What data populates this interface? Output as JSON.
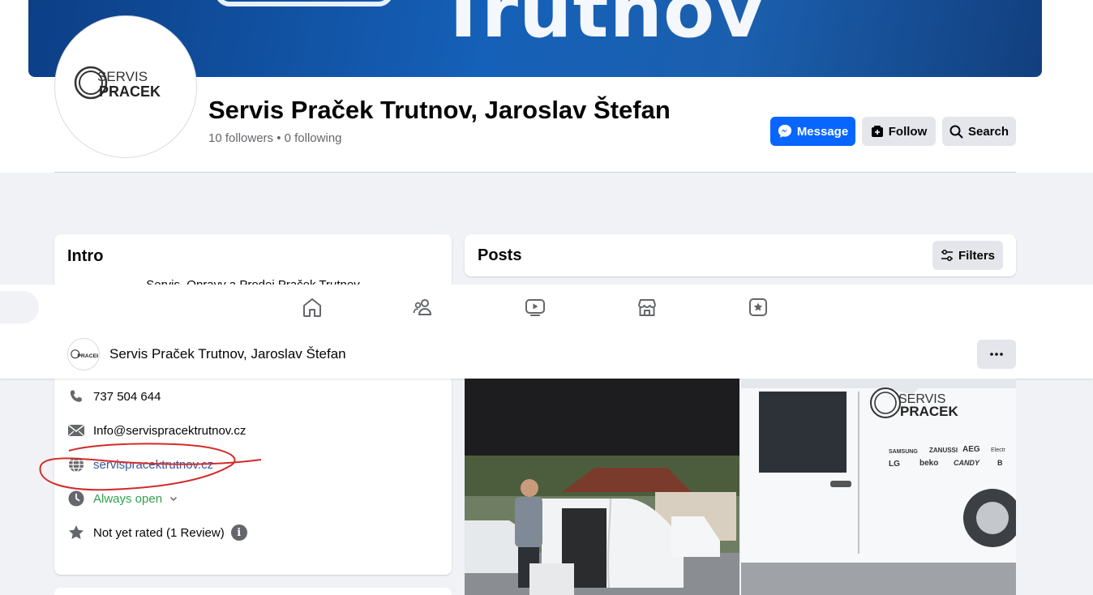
{
  "cover": {
    "text": "Trutnov"
  },
  "profile": {
    "name": "Servis Praček Trutnov, Jaroslav Štefan",
    "stats": "10 followers • 0 following",
    "logo_text_top": "SERVIS",
    "logo_text_bottom": "PRACEK"
  },
  "actions": {
    "message": "Message",
    "follow": "Follow",
    "search": "Search"
  },
  "intro": {
    "title": "Intro",
    "description": "Servis, Opravy a Prodej Praček Trutnov",
    "phone": "737 504 644",
    "email": "Info@servispracektrutnov.cz",
    "website": "servispracektrutnov.cz",
    "hours": "Always open",
    "rating": "Not yet rated (1 Review)",
    "info_glyph": "i"
  },
  "posts": {
    "title": "Posts",
    "filters": "Filters"
  },
  "sticky": {
    "name": "Servis Praček Trutnov, Jaroslav Štefan"
  },
  "nav": {
    "icons": [
      "home-icon",
      "friends-icon",
      "video-icon",
      "marketplace-icon",
      "gaming-icon"
    ]
  },
  "photo2": {
    "van_logo_top": "SERVIS",
    "van_logo_bottom": "PRACEK",
    "brands_row1": [
      "SAMSUNG",
      "ZANUSSI",
      "AEG",
      "Electr"
    ],
    "brands_row2": [
      "LG",
      "beko",
      "CANDY",
      "B"
    ]
  },
  "colors": {
    "accent": "#0866ff",
    "link": "#385898",
    "open": "#31a24c",
    "annotation": "#d42a2a"
  }
}
